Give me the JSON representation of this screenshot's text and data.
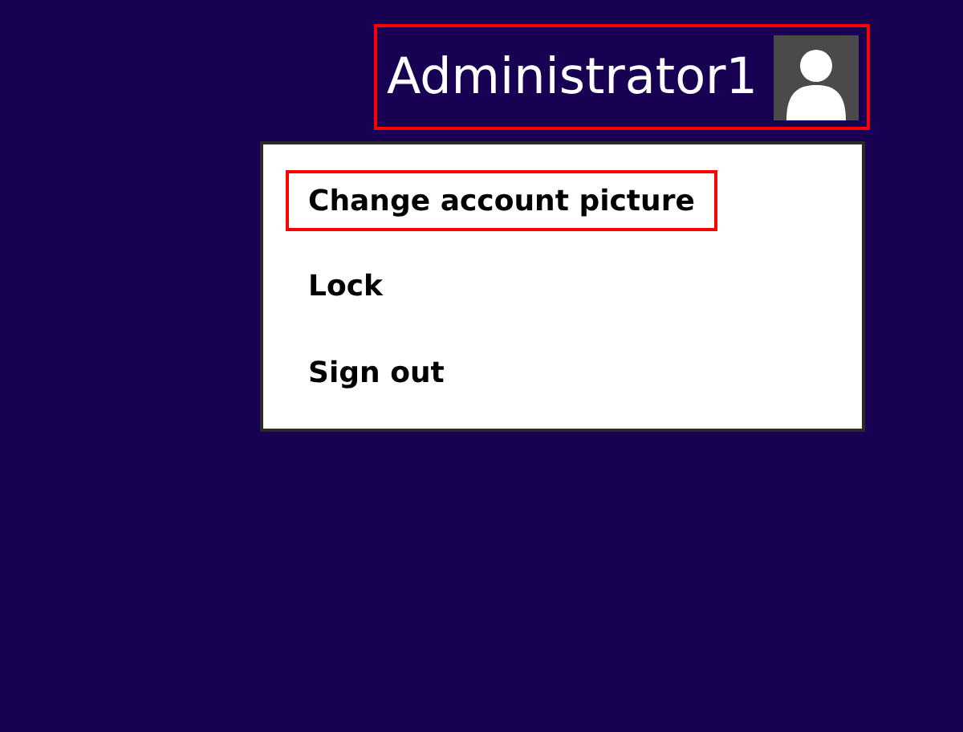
{
  "account": {
    "name": "Administrator1",
    "highlighted": true
  },
  "menu": {
    "items": [
      {
        "label": "Change account picture",
        "highlighted": true
      },
      {
        "label": "Lock",
        "highlighted": false
      },
      {
        "label": "Sign out",
        "highlighted": false
      }
    ]
  }
}
